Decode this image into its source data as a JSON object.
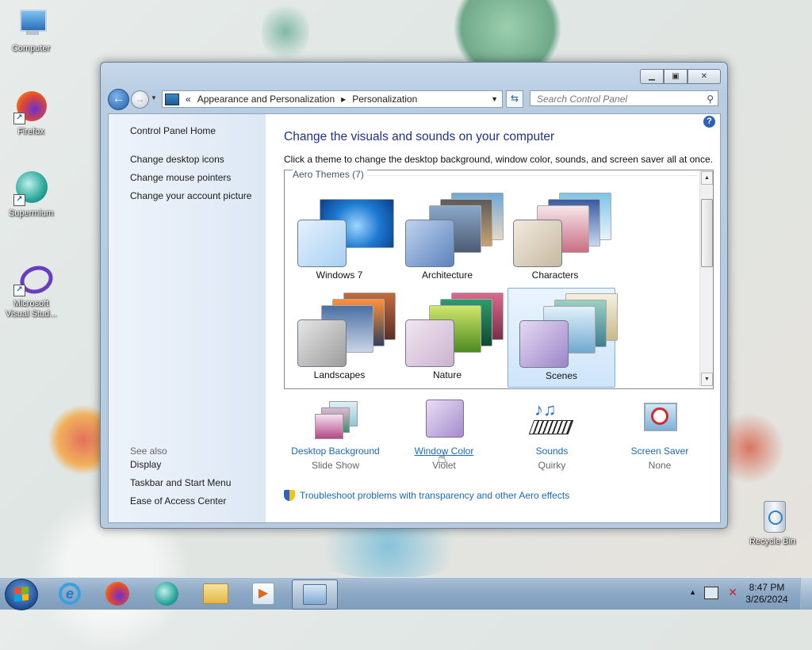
{
  "desktop": {
    "icons": [
      {
        "label": "Computer"
      },
      {
        "label": "Firefox"
      },
      {
        "label": "Supermium"
      },
      {
        "label": "Microsoft Visual Stud..."
      },
      {
        "label": "Recycle Bin"
      }
    ]
  },
  "window": {
    "address": {
      "prefix": "«",
      "crumbs": [
        "Appearance and Personalization",
        "Personalization"
      ],
      "separator": "▸"
    },
    "search_placeholder": "Search Control Panel",
    "left_pane": {
      "home": "Control Panel Home",
      "links": [
        "Change desktop icons",
        "Change mouse pointers",
        "Change your account picture"
      ],
      "see_also_title": "See also",
      "see_also": [
        "Display",
        "Taskbar and Start Menu",
        "Ease of Access Center"
      ]
    },
    "main": {
      "heading": "Change the visuals and sounds on your computer",
      "description": "Click a theme to change the desktop background, window color, sounds, and screen saver all at once.",
      "group_header": "Aero Themes (7)",
      "themes": [
        {
          "name": "Windows 7",
          "selected": false
        },
        {
          "name": "Architecture",
          "selected": false
        },
        {
          "name": "Characters",
          "selected": false
        },
        {
          "name": "Landscapes",
          "selected": false
        },
        {
          "name": "Nature",
          "selected": false
        },
        {
          "name": "Scenes",
          "selected": true
        }
      ],
      "options": [
        {
          "label": "Desktop Background",
          "value": "Slide Show"
        },
        {
          "label": "Window Color",
          "value": "Violet"
        },
        {
          "label": "Sounds",
          "value": "Quirky"
        },
        {
          "label": "Screen Saver",
          "value": "None"
        }
      ],
      "troubleshoot": "Troubleshoot problems with transparency and other Aero effects"
    }
  },
  "taskbar": {
    "time": "8:47 PM",
    "date": "3/26/2024"
  },
  "colors": {
    "accent_link": "#1b6ab3",
    "heading": "#1e3287"
  }
}
